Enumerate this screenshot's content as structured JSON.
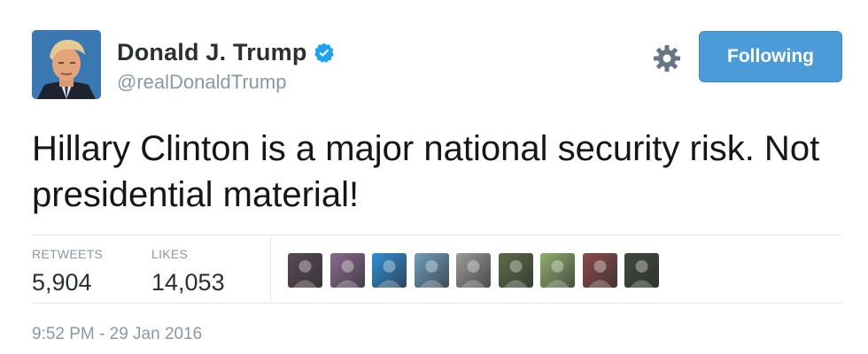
{
  "user": {
    "display_name": "Donald J. Trump",
    "handle": "@realDonaldTrump",
    "verified": true,
    "avatar_icon": "profile-photo"
  },
  "actions": {
    "settings_icon": "gear-icon",
    "follow_label": "Following"
  },
  "tweet": {
    "text": "Hillary Clinton is a major national security risk. Not presidential material!",
    "timestamp": "9:52 PM - 29 Jan 2016"
  },
  "stats": {
    "retweets_label": "RETWEETS",
    "retweets_value": "5,904",
    "likes_label": "LIKES",
    "likes_value": "14,053"
  },
  "likers": [
    {
      "icon": "liker-avatar-1",
      "color": "#5a4a55"
    },
    {
      "icon": "liker-avatar-2",
      "color": "#8a6a8f"
    },
    {
      "icon": "liker-avatar-3",
      "color": "#2f8fd6"
    },
    {
      "icon": "liker-avatar-4",
      "color": "#6f9fbf"
    },
    {
      "icon": "liker-avatar-5",
      "color": "#9a9a9a"
    },
    {
      "icon": "liker-avatar-6",
      "color": "#5d6b48"
    },
    {
      "icon": "liker-avatar-7",
      "color": "#8fae6e"
    },
    {
      "icon": "liker-avatar-8",
      "color": "#8a4a4a"
    },
    {
      "icon": "liker-avatar-9",
      "color": "#3f4a3a"
    }
  ],
  "colors": {
    "accent": "#4b9bd8",
    "muted_text": "#8899a6",
    "verified_badge": "#1da1f2"
  }
}
